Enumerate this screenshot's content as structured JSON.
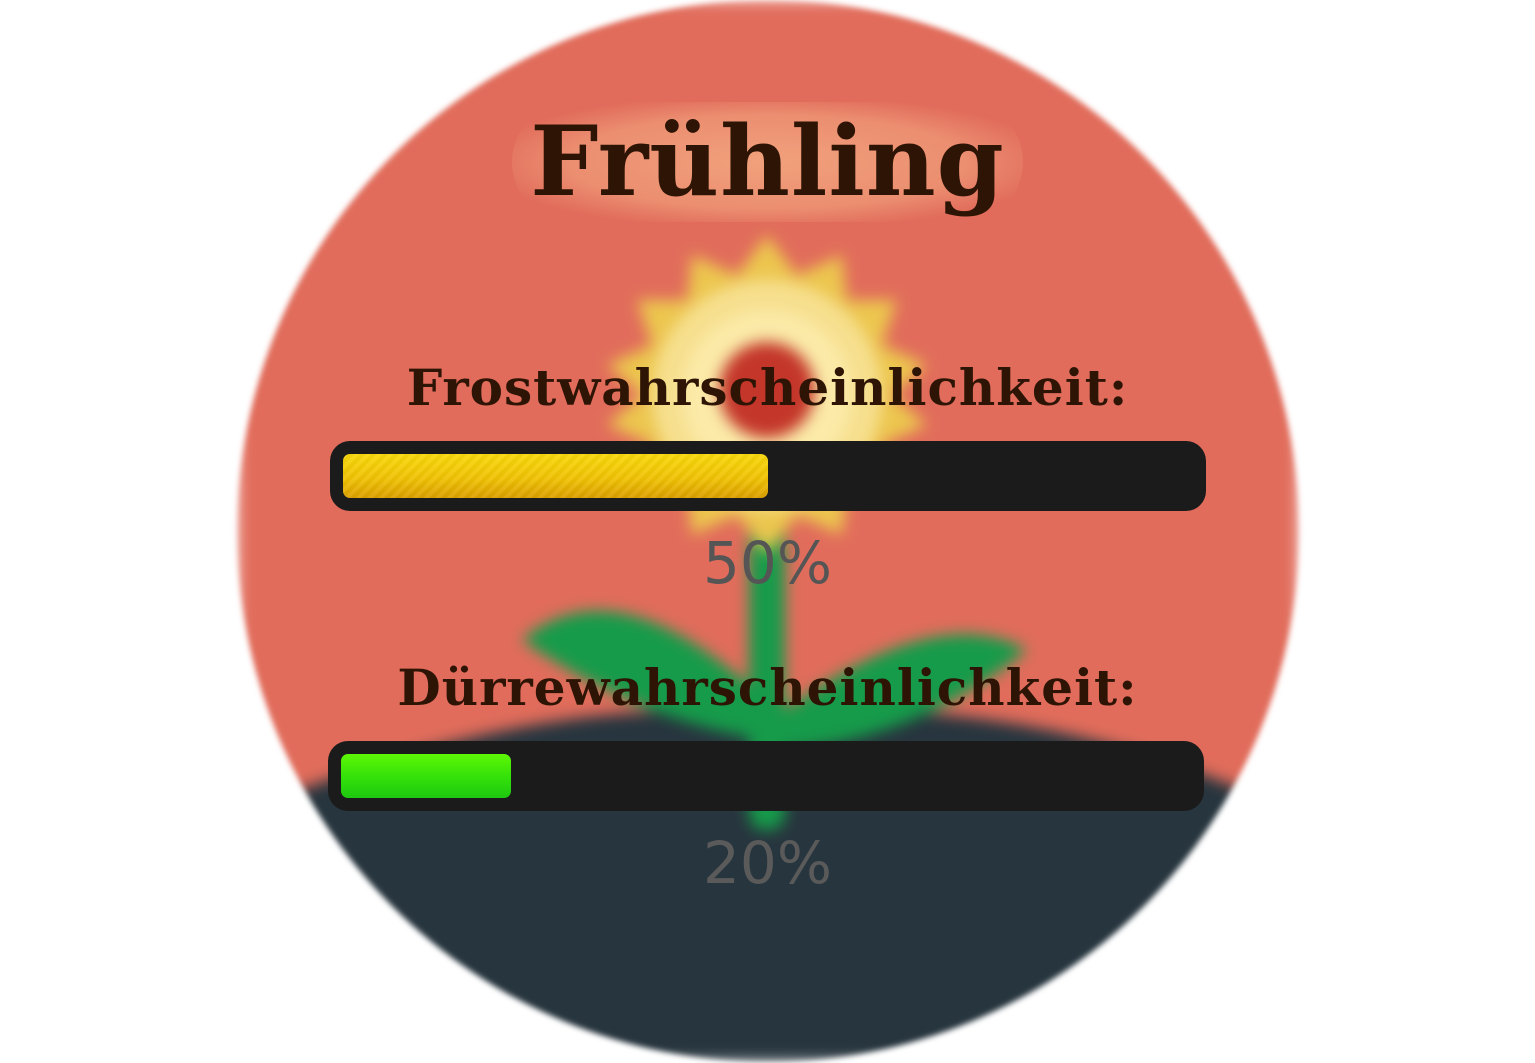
{
  "season": {
    "title": "Frühling"
  },
  "colors": {
    "background_sky": "#e16c5b",
    "background_ground": "#27353e",
    "title_text": "#2e1405",
    "bar_track": "#1b1b1b",
    "frost_fill": "#f0c10a",
    "drought_fill": "#3ee60a",
    "percent_text": "#555555"
  },
  "background": {
    "icon": "sunflower-icon"
  },
  "frost": {
    "label": "Frostwahrscheinlichkeit:",
    "percent_text": "50%",
    "value": 0.5
  },
  "drought": {
    "label": "Dürrewahrscheinlichkeit:",
    "percent_text": "20%",
    "value": 0.2
  }
}
